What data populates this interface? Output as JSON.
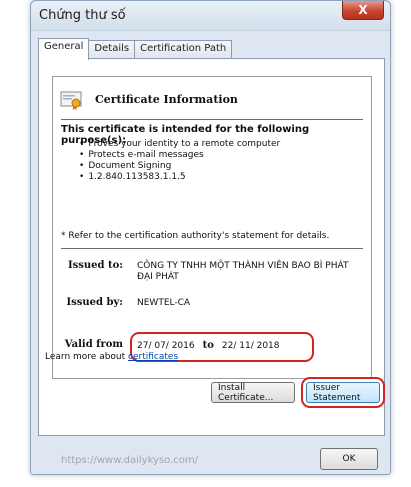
{
  "window": {
    "title": "Chứng thư số",
    "close_label": "X"
  },
  "tabs": [
    {
      "label": "General",
      "active": true
    },
    {
      "label": "Details",
      "active": false
    },
    {
      "label": "Certification Path",
      "active": false
    }
  ],
  "certificate": {
    "info_title": "Certificate Information",
    "purpose_heading": "This certificate is intended for the following purpose(s):",
    "purposes": [
      "Proves your identity to a remote computer",
      "Protects e-mail messages",
      "Document Signing",
      "1.2.840.113583.1.1.5"
    ],
    "refer_note": "* Refer to the certification authority's statement for details.",
    "issued_to_label": "Issued to:",
    "issued_to_value_line1": "CÔNG TY TNHH MỘT THÀNH VIÊN BAO BÌ PHÁT",
    "issued_to_value_line2": "ĐẠI PHÁT",
    "issued_by_label": "Issued by:",
    "issued_by_value": "NEWTEL-CA",
    "valid_from_label": "Valid from",
    "valid_from_date": "27/ 07/ 2016",
    "to_word": "to",
    "valid_to_date": "22/ 11/ 2018"
  },
  "buttons": {
    "install_certificate": "Install Certificate...",
    "issuer_statement": "Issuer Statement",
    "ok": "OK"
  },
  "learn_more": {
    "prefix": "Learn more about ",
    "link": "certificates"
  },
  "watermark": "https://www.dailykyso.com/",
  "colors": {
    "highlight_outline": "#d32324",
    "link": "#0645ad"
  }
}
